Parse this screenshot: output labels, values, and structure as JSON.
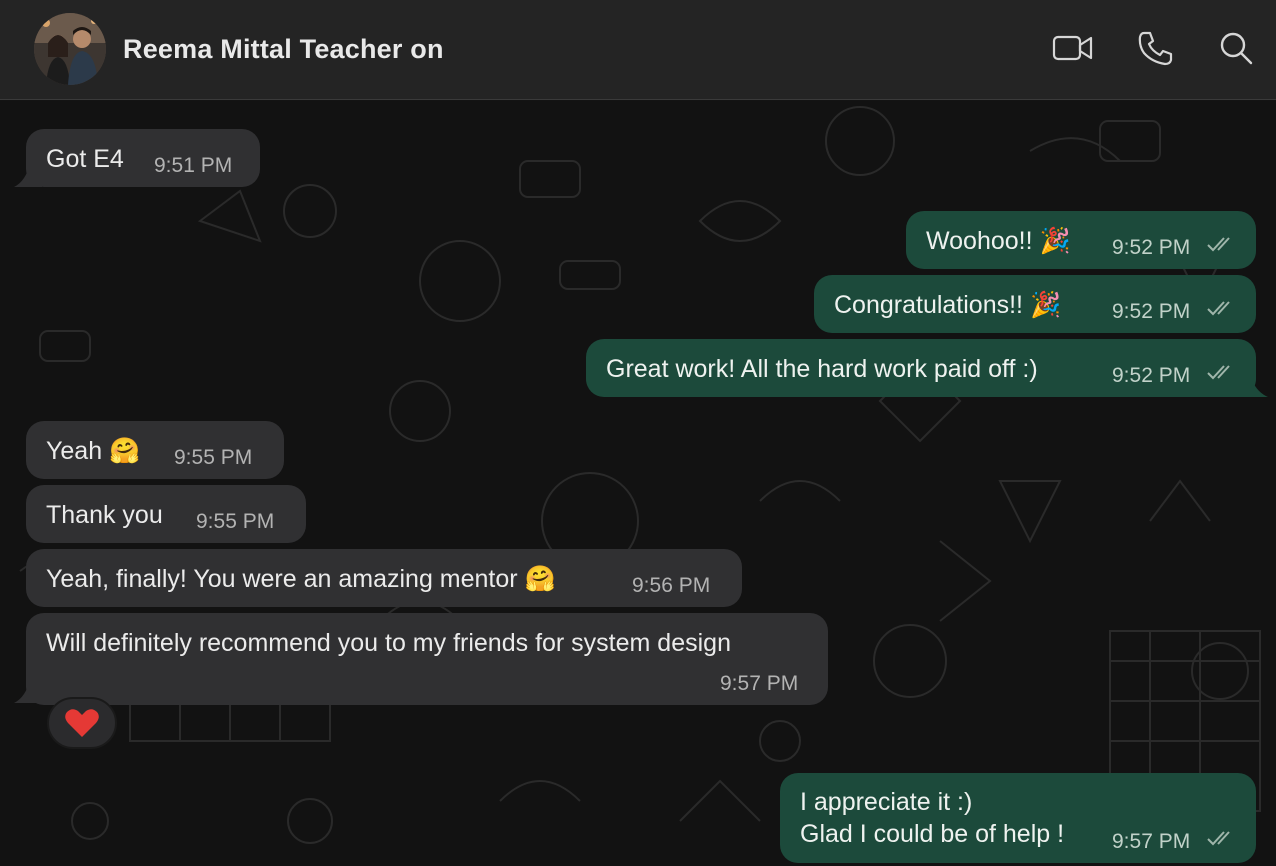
{
  "header": {
    "contact_name": "Reema Mittal Teacher on",
    "icons": [
      "video-call-icon",
      "voice-call-icon",
      "search-icon"
    ]
  },
  "messages": [
    {
      "direction": "in",
      "text": "Got E4",
      "time": "9:51 PM"
    },
    {
      "direction": "out",
      "text": "Woohoo!!",
      "emoji": "🎉",
      "time": "9:52 PM",
      "status": "read"
    },
    {
      "direction": "out",
      "text": "Congratulations!!",
      "emoji": "🎉",
      "time": "9:52 PM",
      "status": "read"
    },
    {
      "direction": "out",
      "text": "Great work! All the hard work paid off :)",
      "time": "9:52 PM",
      "status": "read"
    },
    {
      "direction": "in",
      "text": "Yeah",
      "emoji": "🤗",
      "time": "9:55 PM"
    },
    {
      "direction": "in",
      "text": "Thank you",
      "time": "9:55 PM"
    },
    {
      "direction": "in",
      "text": "Yeah, finally! You were an amazing mentor",
      "emoji": "🤗",
      "time": "9:56 PM"
    },
    {
      "direction": "in",
      "text": "Will definitely recommend you to my friends for system design",
      "time": "9:57 PM",
      "reaction": "❤️"
    },
    {
      "direction": "out",
      "lines": [
        "I appreciate it :)",
        "Glad I could be of help !"
      ],
      "time": "9:57 PM",
      "status": "read"
    }
  ],
  "colors": {
    "incoming_bubble": "#303032",
    "outgoing_bubble": "#1c4a3b",
    "header_bg": "#242424",
    "chat_bg": "#121212"
  }
}
